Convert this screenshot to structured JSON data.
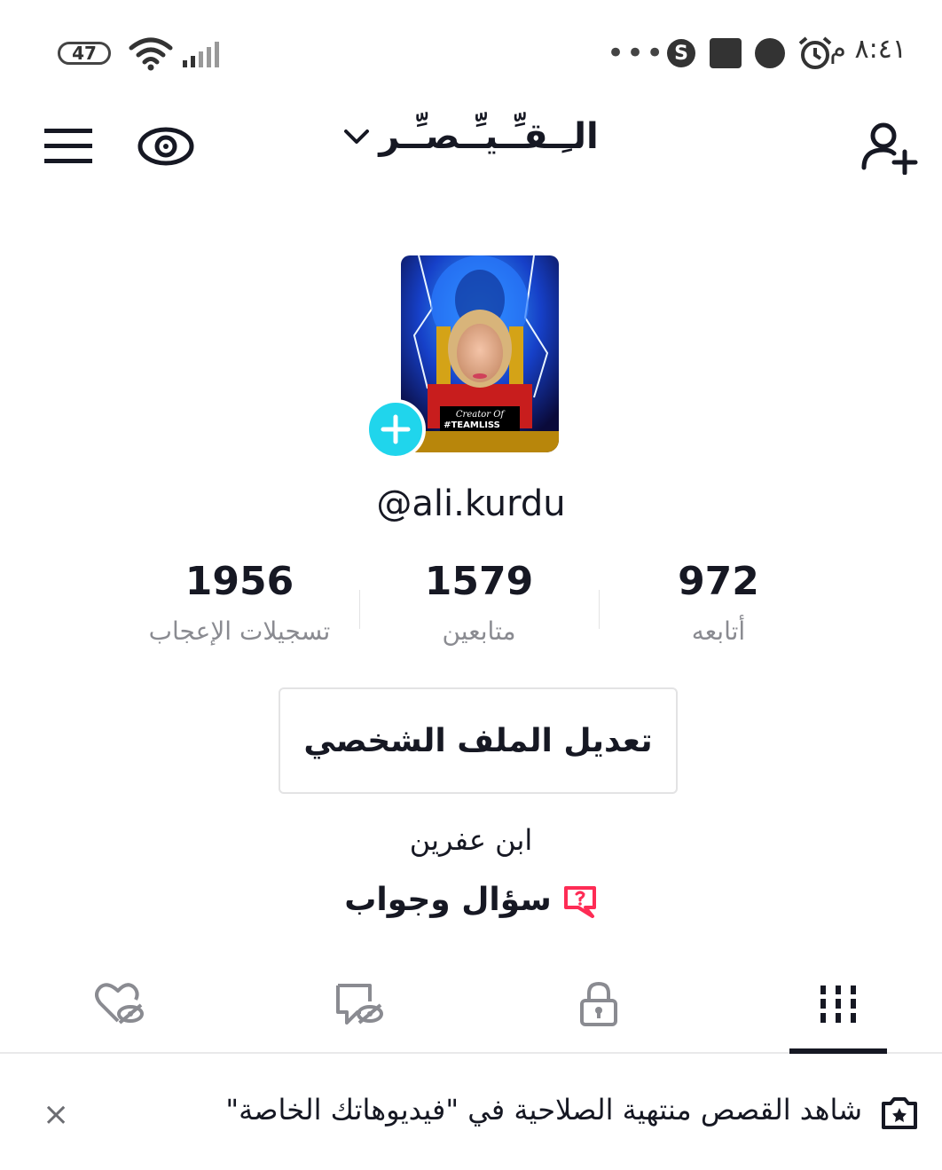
{
  "status_bar": {
    "battery": "47",
    "time": "٨:٤١ م",
    "dots": "•••",
    "shazam_glyph": "S"
  },
  "header": {
    "title": "الـِـقـِّـيـِّـصـِّـر"
  },
  "profile": {
    "badge_text_1": "Creator Of",
    "badge_text_2": "#TEAMLISS",
    "username": "@ali.kurdu",
    "stats": [
      {
        "value": "972",
        "label": "أتابعه"
      },
      {
        "value": "1579",
        "label": "متابعين"
      },
      {
        "value": "1956",
        "label": "تسجيلات الإعجاب"
      }
    ],
    "edit_button": "تعديل الملف الشخصي",
    "bio": "ابن عفرين",
    "qa_label": "سؤال وجواب"
  },
  "tabs": [
    {
      "icon": "grid-icon",
      "active": true
    },
    {
      "icon": "lock-icon",
      "active": false
    },
    {
      "icon": "repost-hidden-icon",
      "active": false
    },
    {
      "icon": "liked-hidden-icon",
      "active": false
    }
  ],
  "banner": {
    "text": "شاهد القصص منتهية الصلاحية في \"فيديوهاتك الخاصة\"",
    "close": "×"
  },
  "colors": {
    "accent_cyan": "#20d5ec",
    "qa_pink": "#fe2c55",
    "text": "#161823",
    "muted": "#8a8b91"
  }
}
